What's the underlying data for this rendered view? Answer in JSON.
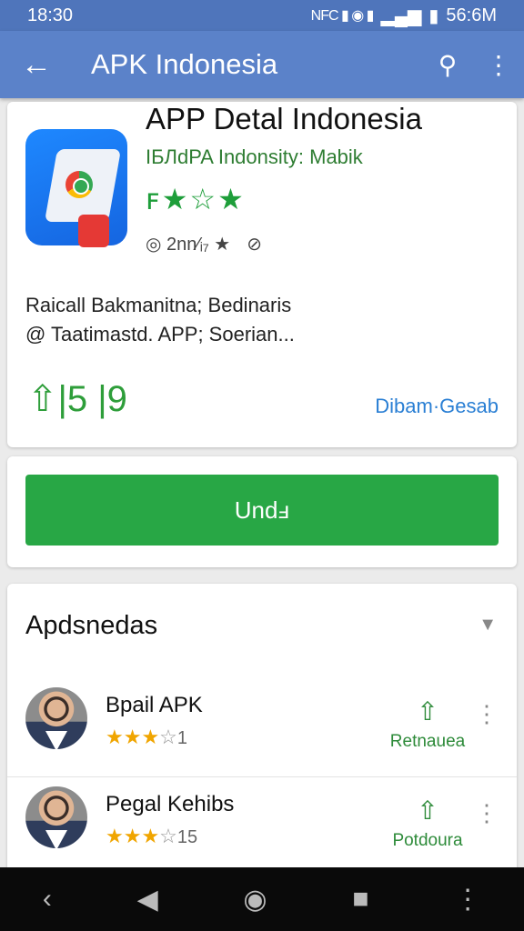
{
  "status": {
    "time": "18:30",
    "battery": "56:6M",
    "icons": "NFC ▮ ◉ ▮"
  },
  "appbar": {
    "title": "APK Indonesia",
    "back_icon": "back-arrow-icon",
    "search_icon": "search-icon",
    "more_icon": "more-icon"
  },
  "detail": {
    "app_name": "APP Detal Indonesia",
    "subtitle": "IБЛdPA Indonsity: Mabik",
    "stars": "ꜰ★☆★",
    "meta_rating": "◎ 2nn⁄ᵢ₇ ★",
    "meta_icon": "⊘",
    "desc_line1": "Raicall Bakmanitna; Bedinaris",
    "desc_line2": "@ Taatimastd. APP; Soerian...",
    "downloads": "⇧|5 |9",
    "developer_link": "Dibam·Gesab"
  },
  "install": {
    "label": "Undⅎ"
  },
  "updates": {
    "title": "Apdsnedas",
    "items": [
      {
        "name": "Bpail APK",
        "stars_full": "★★★",
        "stars_empty": "☆",
        "count": "1",
        "action": "Retnauea"
      },
      {
        "name": "Pegal Kehibs",
        "stars_full": "★★★",
        "stars_empty": "☆",
        "count": "15",
        "action": "Potdoura"
      }
    ]
  },
  "nav": {
    "back": "‹",
    "home_triangle": "◀",
    "home": "◉",
    "recents": "■",
    "menu": "⋮"
  },
  "colors": {
    "appbar": "#5b82c9",
    "install": "#28a745",
    "accent_green": "#2e9e3a",
    "link": "#2a7fd4"
  }
}
